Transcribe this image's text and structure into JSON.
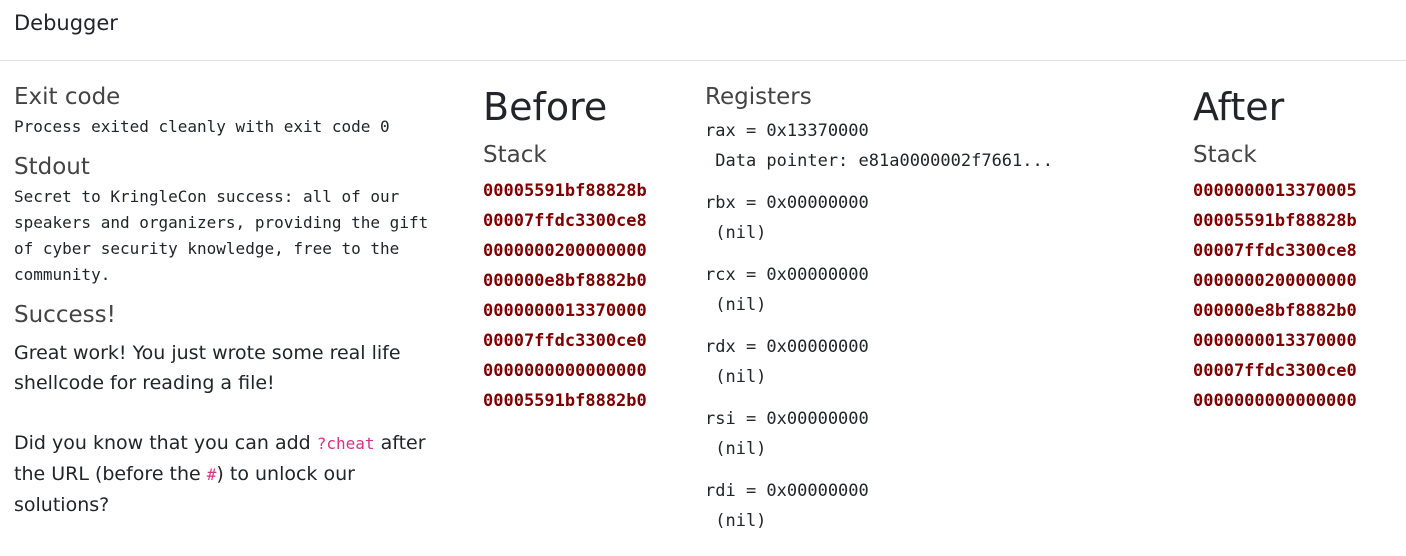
{
  "header": {
    "title": "Debugger"
  },
  "left": {
    "exit_heading": "Exit code",
    "exit_text": "Process exited cleanly with exit code 0",
    "stdout_heading": "Stdout",
    "stdout_text": "Secret to KringleCon success: all of our speakers and organizers, providing the gift of cyber security knowledge, free to the community.",
    "success_heading": "Success!",
    "success_text": "Great work! You just wrote some real life shellcode for reading a file!",
    "tip_part1": "Did you know that you can add ",
    "tip_code1": "?cheat",
    "tip_part2": " after the URL (before the ",
    "tip_code2": "#",
    "tip_part3": ") to unlock our solutions?"
  },
  "before": {
    "title": "Before",
    "stack_label": "Stack",
    "stack": [
      "00005591bf88828b",
      "00007ffdc3300ce8",
      "0000000200000000",
      "000000e8bf8882b0",
      "0000000013370000",
      "00007ffdc3300ce0",
      "0000000000000000",
      "00005591bf8882b0"
    ]
  },
  "registers": {
    "title": "Registers",
    "items": [
      {
        "line": "rax = 0x13370000",
        "detail": " Data pointer: e81a0000002f7661..."
      },
      {
        "line": "rbx = 0x00000000",
        "detail": " (nil)"
      },
      {
        "line": "rcx = 0x00000000",
        "detail": " (nil)"
      },
      {
        "line": "rdx = 0x00000000",
        "detail": " (nil)"
      },
      {
        "line": "rsi = 0x00000000",
        "detail": " (nil)"
      },
      {
        "line": "rdi = 0x00000000",
        "detail": " (nil)"
      }
    ]
  },
  "after": {
    "title": "After",
    "stack_label": "Stack",
    "stack": [
      "0000000013370005",
      "00005591bf88828b",
      "00007ffdc3300ce8",
      "0000000200000000",
      "000000e8bf8882b0",
      "0000000013370000",
      "00007ffdc3300ce0",
      "0000000000000000"
    ]
  },
  "colors": {
    "stack_value": "#800000",
    "inline_code": "#d63384",
    "divider": "#dee2e6"
  }
}
